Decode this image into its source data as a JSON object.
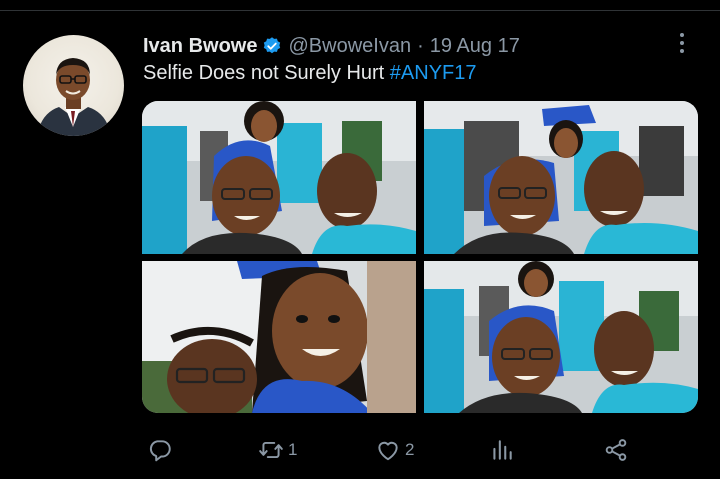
{
  "tweet": {
    "author_name": "Ivan Bwowe",
    "handle": "@BwoweIvan",
    "separator": "·",
    "date": "19 Aug 17",
    "text": "Selfie Does not Surely Hurt",
    "hashtag": "#ANYF17"
  },
  "actions": {
    "reply_count": "",
    "retweet_count": "1",
    "like_count": "2",
    "views_count": ""
  },
  "icons": {
    "verified": "verified-badge-icon",
    "more": "more-vertical-icon",
    "reply": "reply-icon",
    "retweet": "retweet-icon",
    "like": "heart-icon",
    "views": "analytics-icon",
    "share": "share-icon"
  },
  "colors": {
    "background": "#000000",
    "text": "#e7e9ea",
    "secondary": "#8b98a5",
    "accent": "#1d9bf0"
  }
}
